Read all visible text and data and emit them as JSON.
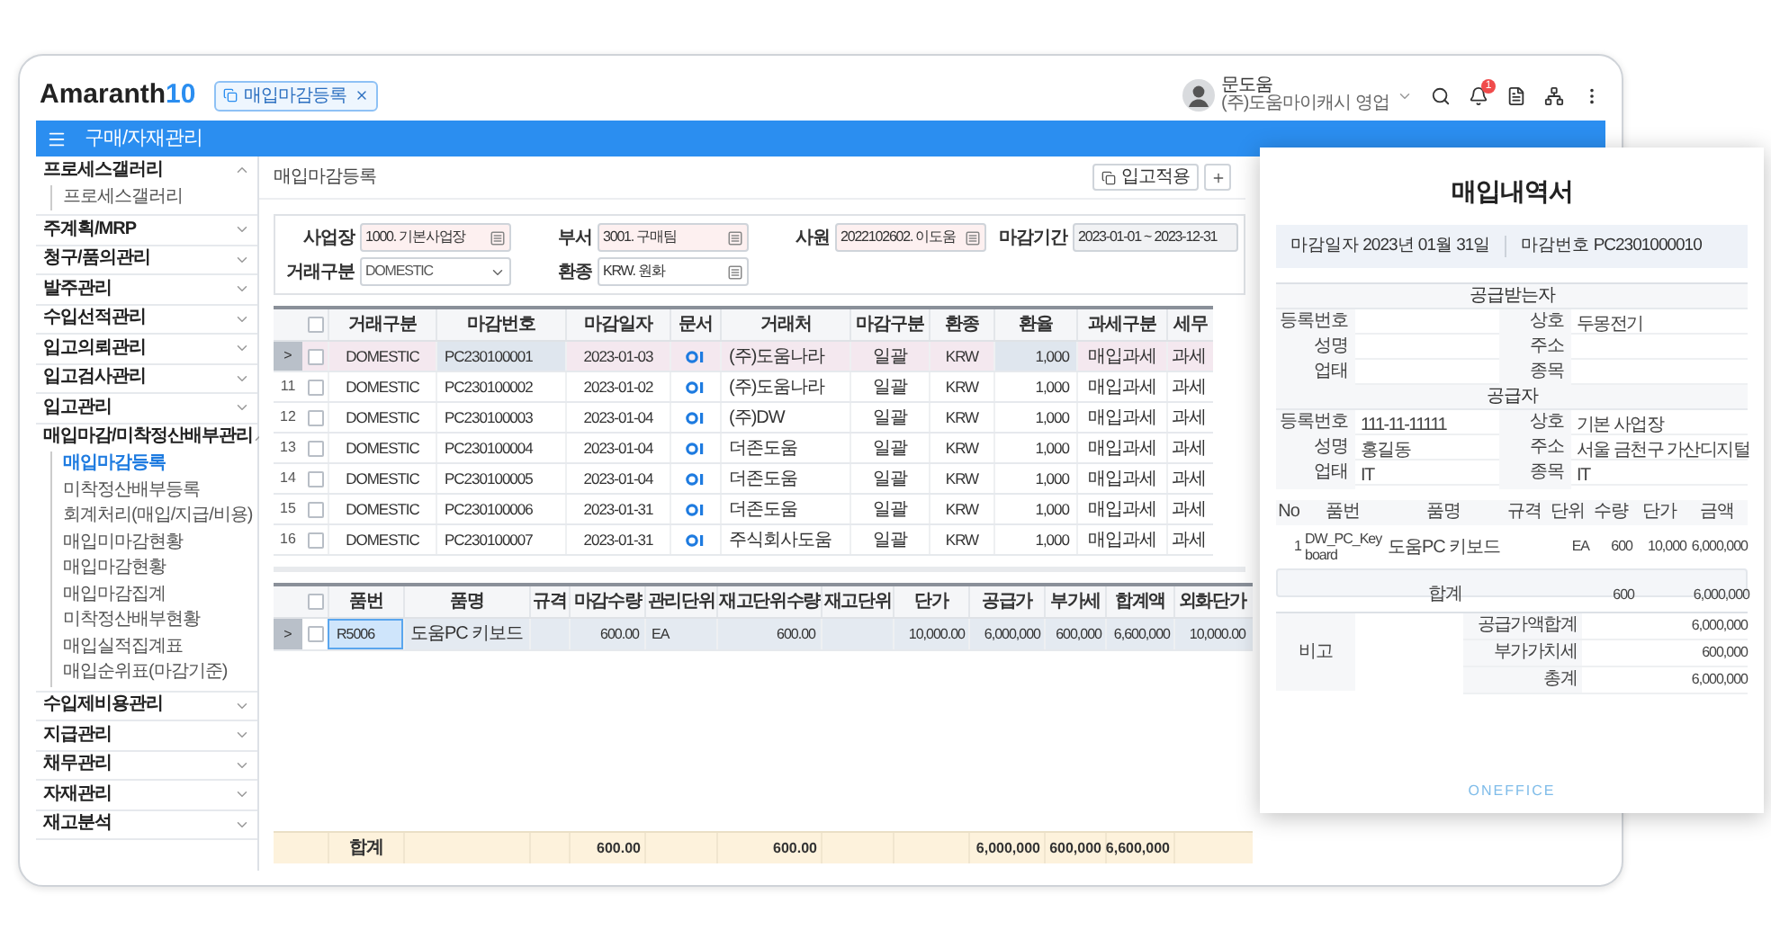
{
  "header": {
    "logo_text": "Amaranth",
    "logo_number": "10",
    "tab": {
      "label": "매입마감등록",
      "selected": true
    },
    "user": {
      "name": "문도움",
      "company": "(주)도움마이캐시 영업"
    },
    "notification_count": "1"
  },
  "module_bar": {
    "title": "구매/자재관리"
  },
  "sidebar": {
    "items": [
      {
        "label": "프로세스갤러리",
        "expanded": true,
        "children": [
          {
            "label": "프로세스갤러리",
            "selected": false
          }
        ]
      },
      {
        "label": "주계획/MRP",
        "expanded": false
      },
      {
        "label": "청구/품의관리",
        "expanded": false
      },
      {
        "label": "발주관리",
        "expanded": false
      },
      {
        "label": "수입선적관리",
        "expanded": false
      },
      {
        "label": "입고의뢰관리",
        "expanded": false
      },
      {
        "label": "입고검사관리",
        "expanded": false
      },
      {
        "label": "입고관리",
        "expanded": false
      },
      {
        "label": "매입마감/미착정산배부관리",
        "expanded": true,
        "children": [
          {
            "label": "매입마감등록",
            "selected": true
          },
          {
            "label": "미착정산배부등록",
            "selected": false
          },
          {
            "label": "회계처리(매입/지급/비용)",
            "selected": false
          },
          {
            "label": "매입미마감현황",
            "selected": false
          },
          {
            "label": "매입마감현황",
            "selected": false
          },
          {
            "label": "매입마감집계",
            "selected": false
          },
          {
            "label": "미착정산배부현황",
            "selected": false
          },
          {
            "label": "매입실적집계표",
            "selected": false
          },
          {
            "label": "매입순위표(마감기준)",
            "selected": false
          }
        ]
      },
      {
        "label": "수입제비용관리",
        "expanded": false
      },
      {
        "label": "지급관리",
        "expanded": false
      },
      {
        "label": "채무관리",
        "expanded": false
      },
      {
        "label": "자재관리",
        "expanded": false
      },
      {
        "label": "재고분석",
        "expanded": false
      }
    ]
  },
  "page": {
    "title": "매입마감등록",
    "buttons": [
      {
        "label": "입고적용"
      }
    ]
  },
  "filters": [
    {
      "label": "사업장",
      "value": "1000. 기본사업장",
      "kind": "lookup",
      "required": true
    },
    {
      "label": "부서",
      "value": "3001. 구매팀",
      "kind": "lookup",
      "required": true
    },
    {
      "label": "사원",
      "value": "2022102602. 이도움",
      "kind": "lookup",
      "required": true
    },
    {
      "label": "마감기간",
      "value": "2023-01-01 ~ 2023-12-31",
      "kind": "range",
      "required": false
    },
    {
      "label": "거래구분",
      "value": "DOMESTIC",
      "kind": "select",
      "required": false
    },
    {
      "label": "환종",
      "value": "KRW. 원화",
      "kind": "lookup",
      "required": false
    }
  ],
  "closing_table": {
    "select_all_checked": false,
    "columns": [
      "거래구분",
      "마감번호",
      "마감일자",
      "문서",
      "거래처",
      "마감구분",
      "환종",
      "환율",
      "과세구분",
      "세무"
    ],
    "rows": [
      {
        "row_header": ">",
        "selected": true,
        "checked": false,
        "has_document": true,
        "cells": [
          "DOMESTIC",
          "PC230100001",
          "2023-01-03",
          "",
          "(주)도움나라",
          "일괄",
          "KRW",
          "1,000",
          "매입과세",
          "과세"
        ]
      },
      {
        "row_header": "11",
        "selected": false,
        "checked": false,
        "has_document": true,
        "cells": [
          "DOMESTIC",
          "PC230100002",
          "2023-01-02",
          "",
          "(주)도움나라",
          "일괄",
          "KRW",
          "1,000",
          "매입과세",
          "과세"
        ]
      },
      {
        "row_header": "12",
        "selected": false,
        "checked": false,
        "has_document": true,
        "cells": [
          "DOMESTIC",
          "PC230100003",
          "2023-01-04",
          "",
          "(주)DW",
          "일괄",
          "KRW",
          "1,000",
          "매입과세",
          "과세"
        ]
      },
      {
        "row_header": "13",
        "selected": false,
        "checked": false,
        "has_document": true,
        "cells": [
          "DOMESTIC",
          "PC230100004",
          "2023-01-04",
          "",
          "더존도움",
          "일괄",
          "KRW",
          "1,000",
          "매입과세",
          "과세"
        ]
      },
      {
        "row_header": "14",
        "selected": false,
        "checked": false,
        "has_document": true,
        "cells": [
          "DOMESTIC",
          "PC230100005",
          "2023-01-04",
          "",
          "더존도움",
          "일괄",
          "KRW",
          "1,000",
          "매입과세",
          "과세"
        ]
      },
      {
        "row_header": "15",
        "selected": false,
        "checked": false,
        "has_document": true,
        "cells": [
          "DOMESTIC",
          "PC230100006",
          "2023-01-31",
          "",
          "더존도움",
          "일괄",
          "KRW",
          "1,000",
          "매입과세",
          "과세"
        ]
      },
      {
        "row_header": "16",
        "selected": false,
        "checked": false,
        "has_document": true,
        "cells": [
          "DOMESTIC",
          "PC230100007",
          "2023-01-31",
          "",
          "주식회사도움",
          "일괄",
          "KRW",
          "1,000",
          "매입과세",
          "과세"
        ]
      }
    ]
  },
  "detail_table": {
    "select_all_checked": false,
    "columns": [
      {
        "label": "품번"
      },
      {
        "label": "품명"
      },
      {
        "label": "규격"
      },
      {
        "label": "마감수량"
      },
      {
        "label": "관리단위"
      },
      {
        "label": "재고단위수량"
      },
      {
        "label": "재고단위"
      },
      {
        "label": "단가"
      },
      {
        "label": "공급가"
      },
      {
        "label": "부가세"
      },
      {
        "label": "합계액"
      },
      {
        "label": "외화단가"
      }
    ],
    "rows": [
      {
        "row_header": ">",
        "selected": true,
        "checked": false,
        "cells": [
          {
            "text": "R5006",
            "focused": true
          },
          {
            "text": "도움PC 키보드",
            "focused": false
          },
          {
            "focused": false
          },
          {
            "text": "600.00",
            "focused": false
          },
          {
            "text": "EA",
            "focused": false
          },
          {
            "text": "600.00",
            "focused": false
          },
          {
            "focused": false
          },
          {
            "text": "10,000.00",
            "focused": false
          },
          {
            "text": "6,000,000",
            "focused": false
          },
          {
            "text": "600,000",
            "focused": false
          },
          {
            "text": "6,600,000",
            "focused": false
          },
          {
            "text": "10,000.00",
            "focused": false
          }
        ]
      }
    ],
    "totals": [
      {
        "kind": "label",
        "text": "합계"
      },
      {
        "kind": "blank"
      },
      {
        "kind": "blank"
      },
      {
        "kind": "value",
        "text": "600.00"
      },
      {
        "kind": "blank"
      },
      {
        "kind": "value",
        "text": "600.00"
      },
      {
        "kind": "blank"
      },
      {
        "kind": "blank"
      },
      {
        "kind": "value",
        "text": "6,000,000"
      },
      {
        "kind": "value",
        "text": "600,000"
      },
      {
        "kind": "value",
        "text": "6,600,000"
      },
      {
        "kind": "blank"
      }
    ]
  },
  "document": {
    "title": "매입내역서",
    "closing_date": "마감일자 2023년 01월 31일",
    "closing_number": "마감번호 PC2301000010",
    "sections": [
      {
        "title": "공급받는자",
        "rows": [
          [
            {
              "label": "등록번호"
            },
            {
              "label": "상호",
              "value": "두몽전기"
            }
          ],
          [
            {
              "label": "성명"
            },
            {
              "label": "주소"
            }
          ],
          [
            {
              "label": "업태"
            },
            {
              "label": "종목"
            }
          ]
        ]
      },
      {
        "title": "공급자",
        "rows": [
          [
            {
              "label": "등록번호",
              "value": "111-11-11111"
            },
            {
              "label": "상호",
              "value": "기본 사업장"
            }
          ],
          [
            {
              "label": "성명",
              "value": "홍길동"
            },
            {
              "label": "주소",
              "value": "서울 금천구 가산디지털"
            }
          ],
          [
            {
              "label": "업태",
              "value": "IT"
            },
            {
              "label": "종목",
              "value": "IT"
            }
          ]
        ]
      }
    ],
    "items": {
      "columns": [
        {
          "label": "No"
        },
        {
          "label": "품번"
        },
        {
          "label": "품명",
          "total": "합계"
        },
        {
          "label": "규격"
        },
        {
          "label": "단위"
        },
        {
          "label": "수량",
          "total": "600"
        },
        {
          "label": "단가"
        },
        {
          "label": "금액",
          "total": "6,000,000"
        }
      ],
      "rows": [
        {
          "no": "1",
          "part_no": "DW_PC_Keyboard",
          "part_name": "도움PC 키보드",
          "unit": "EA",
          "quantity": "600",
          "unit_price": "10,000",
          "amount": "6,000,000"
        }
      ]
    },
    "remarks": {
      "label": "비고",
      "summary": [
        {
          "label": "공급가액합계",
          "value": "6,000,000"
        },
        {
          "label": "부가가치세",
          "value": "600,000"
        },
        {
          "label": "총계",
          "value": "6,000,000"
        }
      ]
    },
    "footer_logo": "ONEFFICE"
  }
}
